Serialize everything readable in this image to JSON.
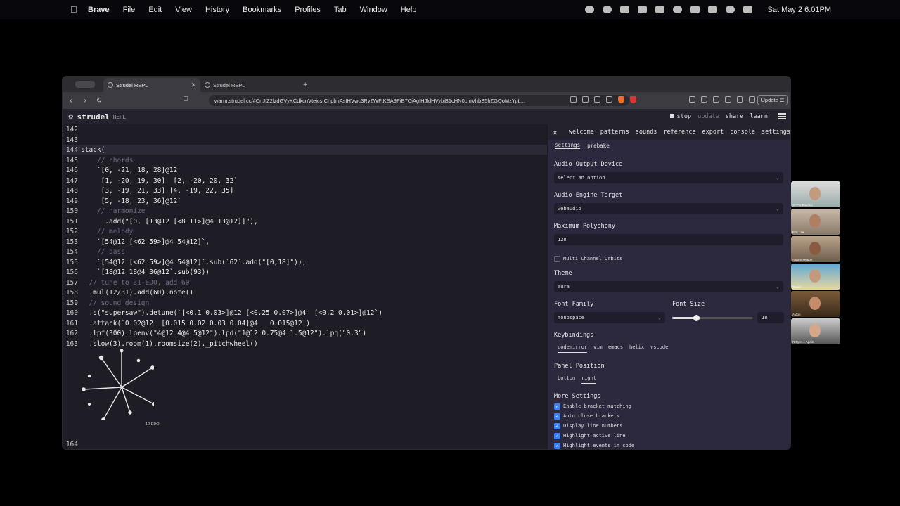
{
  "menubar": {
    "app": "Brave",
    "items": [
      "File",
      "Edit",
      "View",
      "History",
      "Bookmarks",
      "Profiles",
      "Tab",
      "Window",
      "Help"
    ],
    "clock": "Sat May 2  6:01PM"
  },
  "browser": {
    "tabs": [
      {
        "label": "Strudel REPL"
      },
      {
        "label": "Strudel REPL"
      }
    ],
    "url": "warm.strudel.cc/#CnJIZ2lzdGVyKCdkcnVteicsIChpbnAsIHVwc3RyZWFtKSA9PiB7CiAgIHJldHVybiB1cHN0cmVhbS5hZGQoMzYpL...",
    "update_label": "Update"
  },
  "strudel": {
    "title": "strudel",
    "subtitle": "REPL",
    "actions": {
      "stop": "stop",
      "update": "update",
      "share": "share",
      "learn": "learn"
    }
  },
  "editor": {
    "lines": [
      {
        "n": "142",
        "t": ""
      },
      {
        "n": "143",
        "t": ""
      },
      {
        "n": "144",
        "t": "stack("
      },
      {
        "n": "145",
        "t": "    // chords",
        "c": true
      },
      {
        "n": "146",
        "t": "    `[0, -21, 18, 28]@12"
      },
      {
        "n": "147",
        "t": "     [1, -20, 19, 30]  [2, -20, 20, 32]"
      },
      {
        "n": "148",
        "t": "     [3, -19, 21, 33] [4, -19, 22, 35]"
      },
      {
        "n": "149",
        "t": "     [5, -18, 23, 36]@12`"
      },
      {
        "n": "150",
        "t": "    // harmonize",
        "c": true
      },
      {
        "n": "151",
        "t": "      .add(\"[0, [13@12 [<8 11>]@4 13@12]]\"),"
      },
      {
        "n": "152",
        "t": "    // melody",
        "c": true
      },
      {
        "n": "153",
        "t": "    `[54@12 [<62 59>]@4 54@12]`,"
      },
      {
        "n": "154",
        "t": "    // bass",
        "c": true
      },
      {
        "n": "155",
        "t": "    `[54@12 [<62 59>]@4 54@12]`.sub(`62`.add(\"[0,18]\")),"
      },
      {
        "n": "156",
        "t": "    `[18@12 18@4 36@12`.sub(93))"
      },
      {
        "n": "157",
        "t": "  // tune to 31-EDO, add 60",
        "c": true
      },
      {
        "n": "158",
        "t": "  .mul(12/31).add(60).note()"
      },
      {
        "n": "159",
        "t": "  // sound design",
        "c": true
      },
      {
        "n": "160",
        "t": "  .s(\"supersaw\").detune(`[<0.1 0.03>]@12 [<0.25 0.07>]@4  [<0.2 0.01>]@12`)"
      },
      {
        "n": "161",
        "t": "  .attack(`0.02@12  [0.015 0.02 0.03 0.04]@4   0.015@12`)"
      },
      {
        "n": "162",
        "t": "  .lpf(300).lpenv(\"4@12 4@4 5@12\").lpd(\"1@12 0.75@4 1.5@12\").lpq(\"0.3\")"
      },
      {
        "n": "163",
        "t": "  .slow(3).room(1).roomsize(2)._pitchwheel()"
      }
    ],
    "last_line": "164",
    "pitchwheel_label": "12 EDO"
  },
  "panel": {
    "tabs": [
      "welcome",
      "patterns",
      "sounds",
      "reference",
      "export",
      "console",
      "settings"
    ],
    "subtabs": [
      "settings",
      "prebake"
    ],
    "audio_output_label": "Audio Output Device",
    "audio_output_value": "select an option",
    "engine_label": "Audio Engine Target",
    "engine_value": "webaudio",
    "polyphony_label": "Maximum Polyphony",
    "polyphony_value": "128",
    "multichannel_label": "Multi Channel Orbits",
    "theme_label": "Theme",
    "theme_value": "aura",
    "font_family_label": "Font Family",
    "font_family_value": "monospace",
    "font_size_label": "Font Size",
    "font_size_value": "18",
    "keybindings_label": "Keybindings",
    "keybindings": [
      "codemirror",
      "vim",
      "emacs",
      "helix",
      "vscode"
    ],
    "panel_position_label": "Panel Position",
    "panel_positions": [
      "bottom",
      "right"
    ],
    "more_settings_label": "More Settings",
    "more_settings": [
      "Enable bracket matching",
      "Auto close brackets",
      "Display line numbers",
      "Highlight active line",
      "Highlight events in code"
    ]
  },
  "videocall": {
    "participants": [
      "SFPC Teacher",
      "Eric Lee",
      "Aaram Mogoe",
      "David",
      "Aldon",
      "R.Tyler... Again"
    ]
  }
}
